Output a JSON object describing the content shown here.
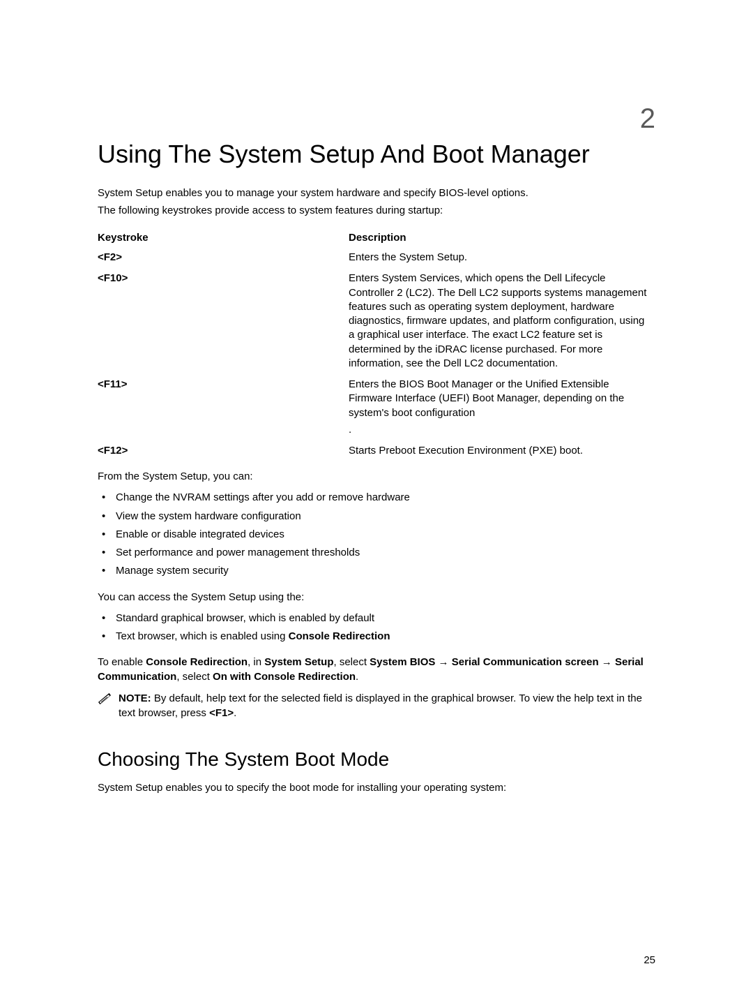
{
  "chapter_number": "2",
  "title": "Using The System Setup And Boot Manager",
  "intro_line1": "System Setup enables you to manage your system hardware and specify BIOS-level options.",
  "intro_line2": "The following keystrokes provide access to system features during startup:",
  "table": {
    "head_keystroke": "Keystroke",
    "head_description": "Description",
    "rows": [
      {
        "key": "<F2>",
        "desc": "Enters the System Setup."
      },
      {
        "key": "<F10>",
        "desc": "Enters System Services, which opens the Dell Lifecycle Controller 2 (LC2). The Dell LC2 supports systems management features such as operating system deployment, hardware diagnostics, firmware updates, and platform configuration, using a graphical user interface. The exact LC2 feature set is determined by the iDRAC license purchased. For more information, see the Dell LC2 documentation."
      },
      {
        "key": "<F11>",
        "desc": "Enters the BIOS Boot Manager or the Unified Extensible Firmware Interface (UEFI) Boot Manager, depending on the system's boot configuration",
        "trail_dot": "."
      },
      {
        "key": "<F12>",
        "desc": "Starts Preboot Execution Environment (PXE) boot."
      }
    ]
  },
  "from_setup_lead": "From the System Setup, you can:",
  "from_setup_items": [
    "Change the NVRAM settings after you add or remove hardware",
    "View the system hardware configuration",
    "Enable or disable integrated devices",
    "Set performance and power management thresholds",
    "Manage system security"
  ],
  "access_lead": "You can access the System Setup using the:",
  "access_items": [
    {
      "plain": "Standard graphical browser, which is enabled by default"
    },
    {
      "plain_prefix": "Text browser, which is enabled using ",
      "bold_suffix": "Console Redirection"
    }
  ],
  "enable_sentence": {
    "p1": "To enable ",
    "b1": "Console Redirection",
    "p2": ", in ",
    "b2": "System Setup",
    "p3": ", select ",
    "b3": "System BIOS ",
    "arrow1": "→ ",
    "b4": "Serial Communication screen ",
    "arrow2": "→ ",
    "b5": "Serial Communication",
    "p4": ", select ",
    "b6": "On with Console Redirection",
    "p5": "."
  },
  "note": {
    "label": "NOTE: ",
    "body1": "By default, help text for the selected field is displayed in the graphical browser. To view the help text in the text browser, press ",
    "bold_key": "<F1>",
    "body2": "."
  },
  "section2_title": "Choosing The System Boot Mode",
  "section2_body": "System Setup enables you to specify the boot mode for installing your operating system:",
  "page_number": "25"
}
